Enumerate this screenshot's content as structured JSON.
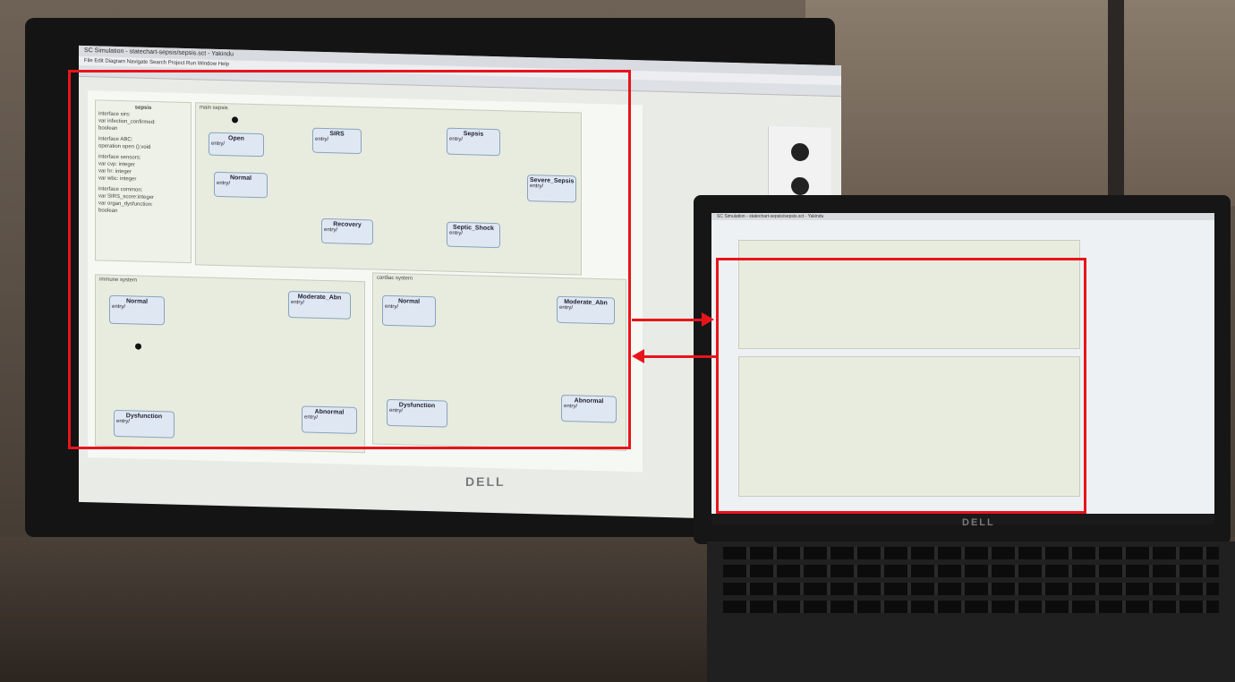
{
  "window_title": "SC Simulation - statechart-sepsis/sepsis.sct - Yakindu",
  "menu": "File  Edit  Diagram  Navigate  Search  Project  Run  Window  Help",
  "statechart": {
    "interface_title": "sepsis",
    "interface_lines": [
      "interface sirs:",
      "var infection_confirmed:",
      "boolean",
      "interface ABC:",
      "operation open ():void",
      "interface sensors:",
      "var cvp: integer",
      "var hr: integer",
      "var wbc: integer",
      "interface common:",
      "var SIRS_score:integer",
      "var organ_dysfunction:",
      "boolean"
    ],
    "main_region": "main sepsis",
    "immune_region": "immune system",
    "cardiac_region": "cardiac system",
    "states": {
      "open": "Open",
      "sirs": "SIRS",
      "sepsis": "Sepsis",
      "normal": "Normal",
      "severe_sepsis": "Severe_Sepsis",
      "recovery": "Recovery",
      "septic_shock": "Septic_Shock",
      "imm_normal": "Normal",
      "imm_moderate": "Moderate_Abn",
      "imm_dysfunction": "Dysfunction",
      "imm_abnormal": "Abnormal",
      "car_normal": "Normal",
      "car_moderate": "Moderate_Abn",
      "car_dysfunction": "Dysfunction",
      "car_abnormal": "Abnormal"
    },
    "entry": "entry/"
  },
  "brand": "DELL",
  "colors": {
    "highlight": "#e8141c"
  }
}
